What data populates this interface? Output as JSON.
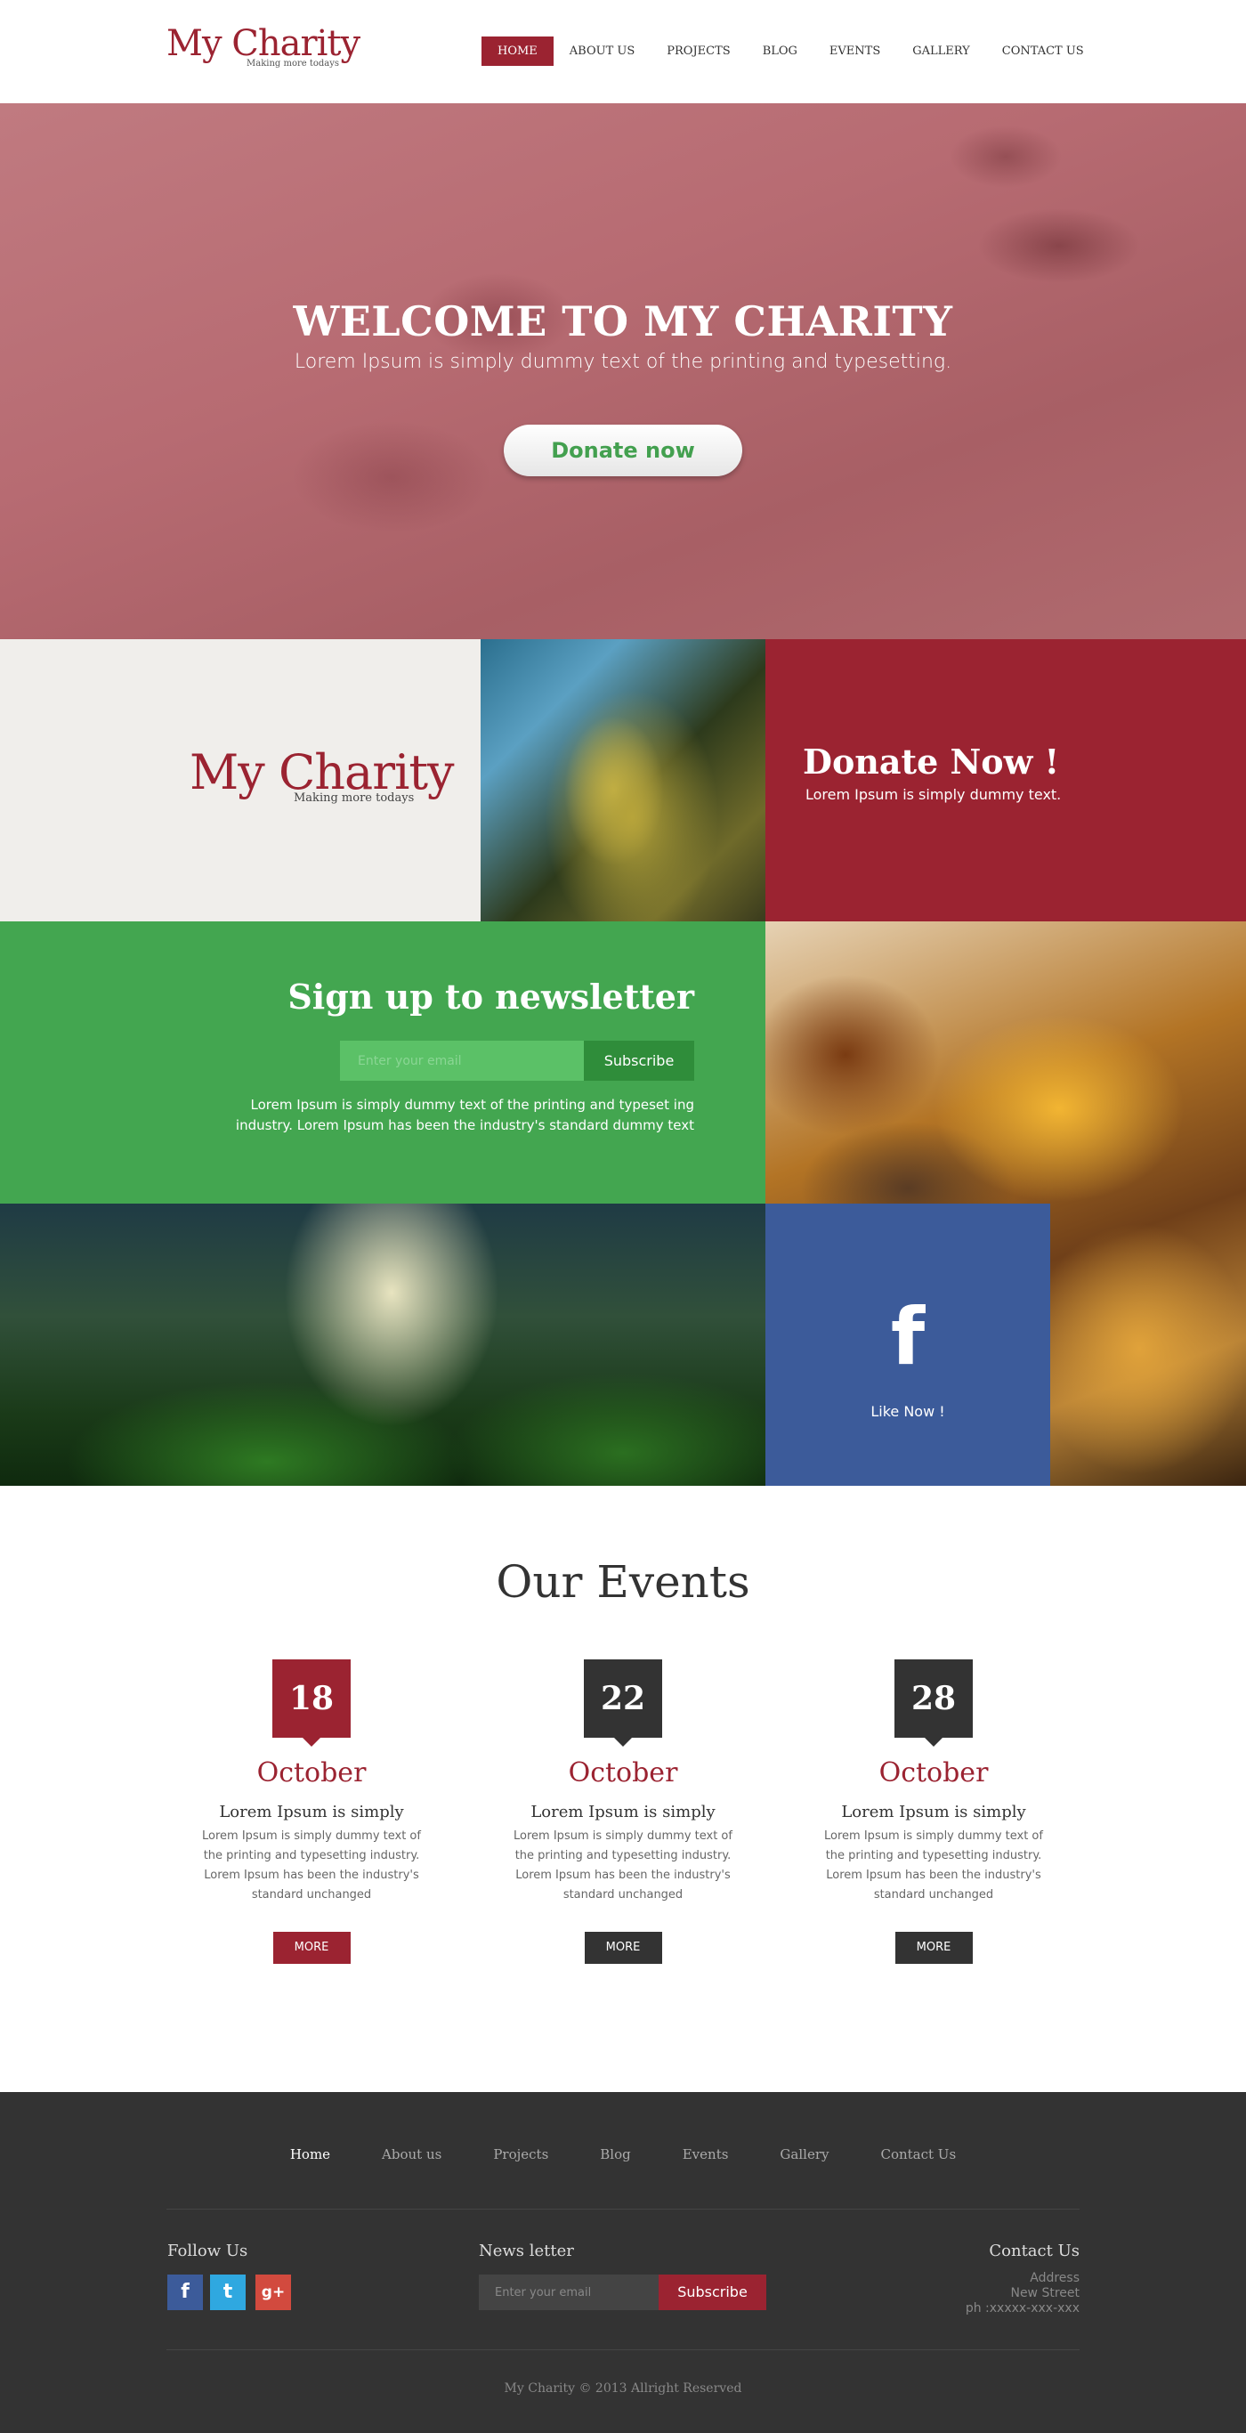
{
  "header": {
    "logo_title": "My Charity",
    "logo_tagline": "Making more todays",
    "nav": [
      "HOME",
      "ABOUT US",
      "PROJECTS",
      "BLOG",
      "EVENTS",
      "GALLERY",
      "CONTACT US"
    ],
    "active_nav": "HOME"
  },
  "hero": {
    "title": "WELCOME TO MY CHARITY",
    "subtitle": "Lorem Ipsum is simply dummy text of the printing and typesetting.",
    "donate_label": "Donate now"
  },
  "tiles": {
    "logo_title": "My Charity",
    "logo_tagline": "Making more todays",
    "donate_title": "Donate Now !",
    "donate_sub": "Lorem Ipsum is simply dummy text.",
    "newsletter_title": "Sign up to newsletter",
    "newsletter_placeholder": "Enter your email",
    "newsletter_button": "Subscribe",
    "newsletter_text": "Lorem Ipsum is simply dummy text of the printing and typeset ing industry. Lorem Ipsum has been the industry's standard dummy text",
    "facebook_icon": "f",
    "facebook_label": "Like Now !"
  },
  "events": {
    "title": "Our Events",
    "items": [
      {
        "day": "18",
        "month": "October",
        "heading": "Lorem Ipsum is simply",
        "text": "Lorem Ipsum is simply dummy text of the printing and typesetting industry. Lorem Ipsum has been the industry's standard unchanged",
        "more": "MORE",
        "color": "#9b2331"
      },
      {
        "day": "22",
        "month": "October",
        "heading": "Lorem Ipsum is simply",
        "text": "Lorem Ipsum is simply dummy text of the printing and typesetting industry. Lorem Ipsum has been the industry's standard unchanged",
        "more": "MORE",
        "color": "#333333"
      },
      {
        "day": "28",
        "month": "October",
        "heading": "Lorem Ipsum is simply",
        "text": "Lorem Ipsum is simply dummy text of the printing and typesetting industry. Lorem Ipsum has been the industry's standard unchanged",
        "more": "MORE",
        "color": "#333333"
      }
    ],
    "month_color": "#9b2331"
  },
  "footer": {
    "nav": [
      "Home",
      "About us",
      "Projects",
      "Blog",
      "Events",
      "Gallery",
      "Contact Us"
    ],
    "active_nav": "Home",
    "follow_title": "Follow Us",
    "social": [
      {
        "icon": "facebook-icon",
        "glyph": "f",
        "color": "#3c5b9a"
      },
      {
        "icon": "twitter-icon",
        "glyph": "t",
        "color": "#2fa8e0"
      },
      {
        "icon": "google-plus-icon",
        "glyph": "g+",
        "color": "#d24a3e"
      }
    ],
    "newsletter_title": "News letter",
    "newsletter_placeholder": "Enter your email",
    "newsletter_button": "Subscribe",
    "contact_title": "Contact Us",
    "contact_lines": [
      "Address",
      "New Street",
      "ph :xxxxx-xxx-xxx"
    ],
    "copyright": "My Charity © 2013 Allright Reserved"
  },
  "colors": {
    "brand_red": "#9b2331",
    "brand_green": "#43a650",
    "facebook_blue": "#3c5b9a",
    "footer_dark": "#333333"
  }
}
